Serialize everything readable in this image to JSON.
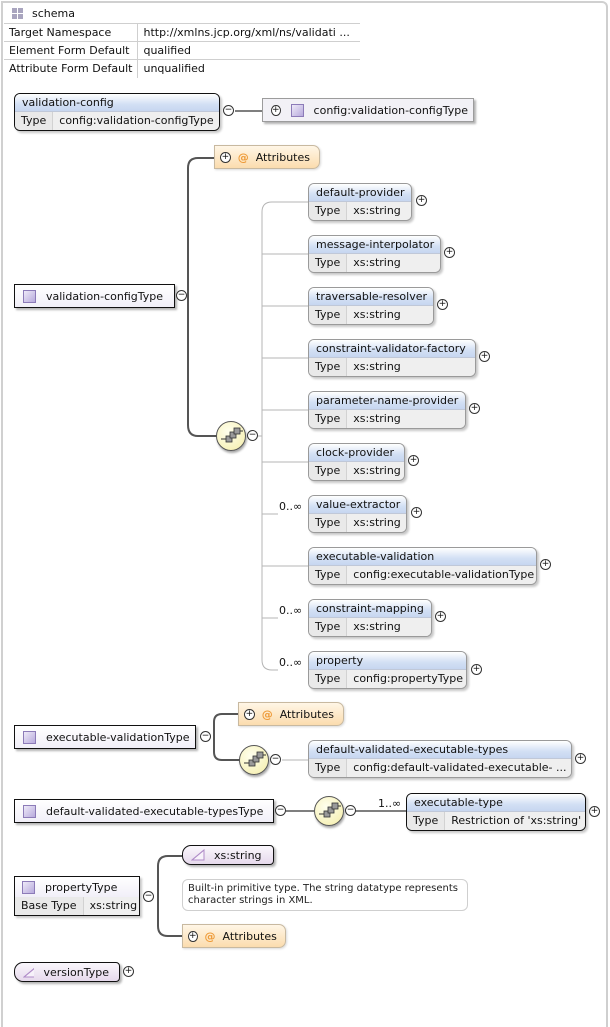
{
  "schema": {
    "title": "schema",
    "properties": [
      {
        "label": "Target Namespace",
        "value": "http://xmlns.jcp.org/xml/ns/validati ..."
      },
      {
        "label": "Element Form Default",
        "value": "qualified"
      },
      {
        "label": "Attribute Form Default",
        "value": "unqualified"
      }
    ]
  },
  "root_element": {
    "name": "validation-config",
    "type_label": "Type",
    "type_value": "config:validation-configType",
    "type_ref": "config:validation-configType"
  },
  "validation_config_type": {
    "name": "validation-configType",
    "attributes_label": "Attributes",
    "children": [
      {
        "name": "default-provider",
        "type_label": "Type",
        "type": "xs:string",
        "occurs": ""
      },
      {
        "name": "message-interpolator",
        "type_label": "Type",
        "type": "xs:string",
        "occurs": ""
      },
      {
        "name": "traversable-resolver",
        "type_label": "Type",
        "type": "xs:string",
        "occurs": ""
      },
      {
        "name": "constraint-validator-factory",
        "type_label": "Type",
        "type": "xs:string",
        "occurs": ""
      },
      {
        "name": "parameter-name-provider",
        "type_label": "Type",
        "type": "xs:string",
        "occurs": ""
      },
      {
        "name": "clock-provider",
        "type_label": "Type",
        "type": "xs:string",
        "occurs": ""
      },
      {
        "name": "value-extractor",
        "type_label": "Type",
        "type": "xs:string",
        "occurs": "0..∞"
      },
      {
        "name": "executable-validation",
        "type_label": "Type",
        "type": "config:executable-validationType",
        "occurs": ""
      },
      {
        "name": "constraint-mapping",
        "type_label": "Type",
        "type": "xs:string",
        "occurs": "0..∞"
      },
      {
        "name": "property",
        "type_label": "Type",
        "type": "config:propertyType",
        "occurs": "0..∞"
      }
    ]
  },
  "executable_validation_type": {
    "name": "executable-validationType",
    "attributes_label": "Attributes",
    "child": {
      "name": "default-validated-executable-types",
      "type_label": "Type",
      "type": "config:default-validated-executable- ..."
    }
  },
  "default_validated_types_type": {
    "name": "default-validated-executable-typesType",
    "occurs": "1..∞",
    "child": {
      "name": "executable-type",
      "type_label": "Type",
      "type": "Restriction of 'xs:string'"
    }
  },
  "property_type": {
    "name": "propertyType",
    "base_label": "Base Type",
    "base_value": "xs:string",
    "simple_type": "xs:string",
    "tooltip": "Built-in primitive type. The string datatype represents character strings in XML.",
    "attributes_label": "Attributes"
  },
  "version_type": {
    "name": "versionType"
  },
  "toggles": {
    "expand": "+",
    "collapse": "−"
  }
}
